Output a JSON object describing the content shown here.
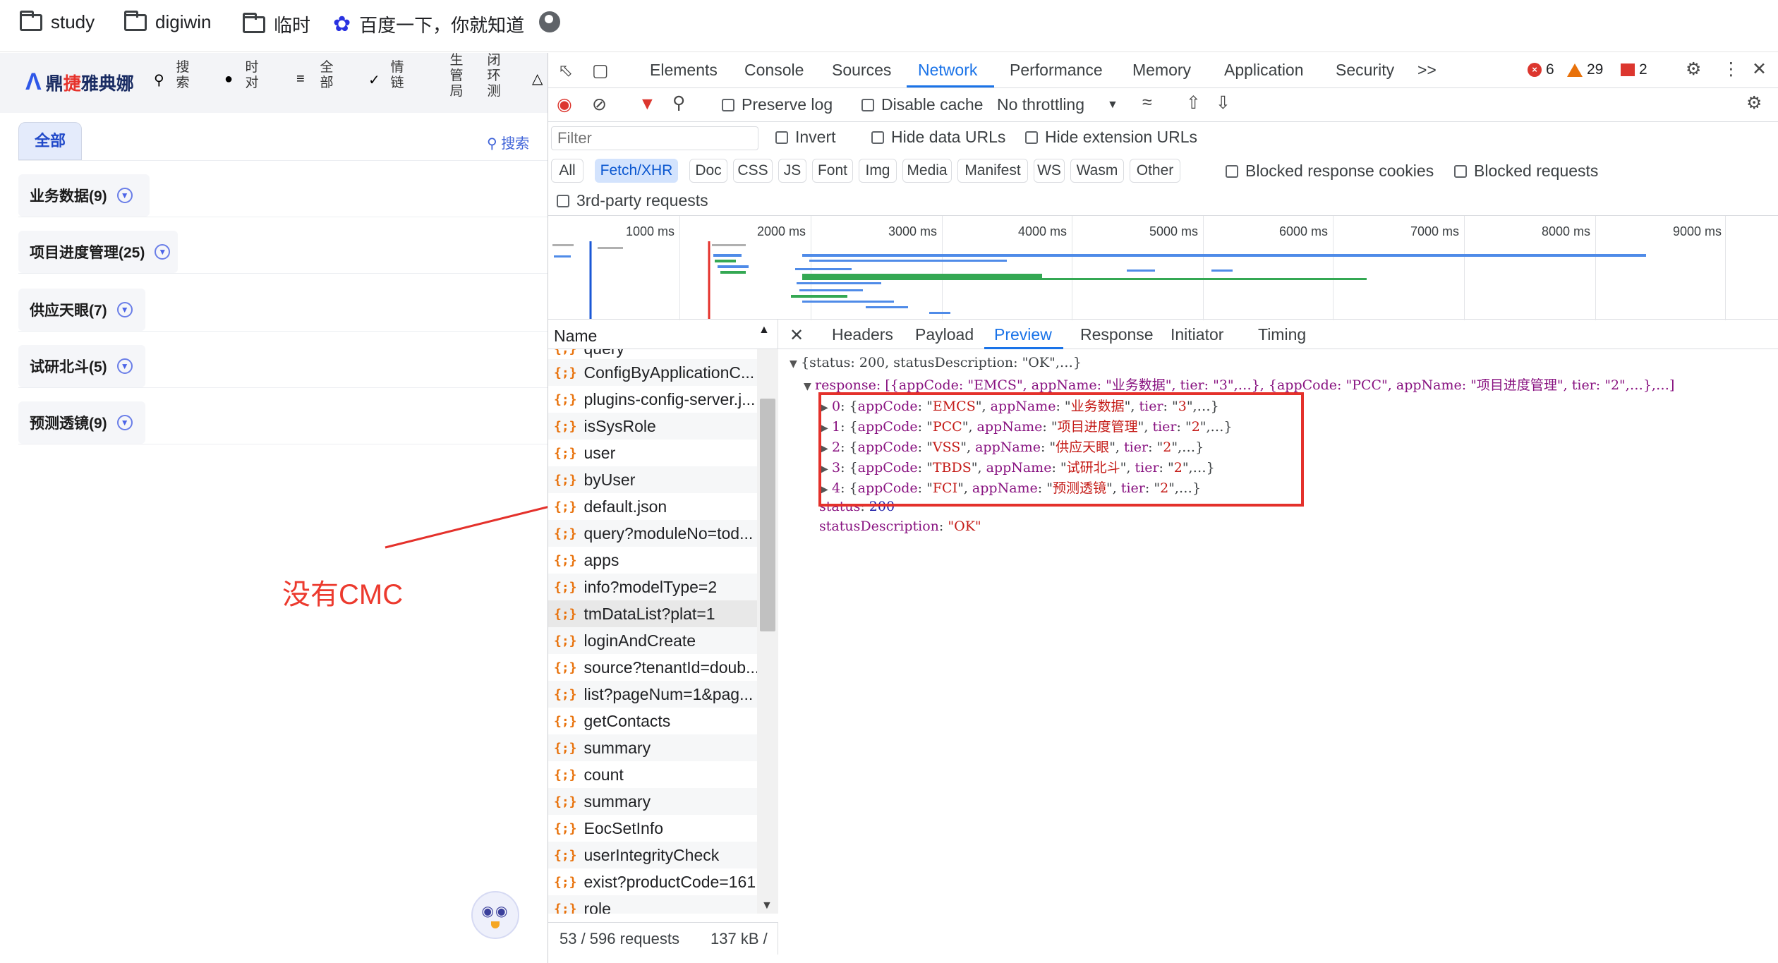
{
  "bookmarks": [
    {
      "label": "study",
      "icon": "folder-icon"
    },
    {
      "label": "digiwin",
      "icon": "folder-icon"
    },
    {
      "label": "临时",
      "icon": "folder-icon"
    },
    {
      "label": "百度一下，你就知道",
      "icon": "paw-icon"
    },
    {
      "label": "",
      "icon": "globe-icon"
    }
  ],
  "app": {
    "logo": {
      "pre": "鼎",
      "red": "捷",
      "post": "雅典娜"
    },
    "nav": [
      {
        "l1": "搜",
        "l2": "索",
        "icon": "search-icon"
      },
      {
        "l1": "时",
        "l2": "对",
        "icon": "chat-icon"
      },
      {
        "l1": "全",
        "l2": "部",
        "icon": "menu-icon"
      },
      {
        "l1": "情",
        "l2": "链",
        "icon": "link-icon"
      },
      {
        "l1": "生",
        "l2": "管",
        "l3": "局",
        "icon": ""
      },
      {
        "l1": "闭",
        "l2": "环",
        "l3": "测",
        "icon": ""
      }
    ],
    "all_tab": "全部",
    "search_label": "搜索",
    "categories": [
      {
        "label": "业务数据(9)"
      },
      {
        "label": "项目进度管理(25)"
      },
      {
        "label": "供应天眼(7)"
      },
      {
        "label": "试研北斗(5)"
      },
      {
        "label": "预测透镜(9)"
      }
    ]
  },
  "annotation": {
    "text": "没有CMC",
    "color": "#ec3a2e"
  },
  "devtools": {
    "tabs": [
      "Elements",
      "Console",
      "Sources",
      "Network",
      "Performance",
      "Memory",
      "Application",
      "Security"
    ],
    "more": ">>",
    "active_tab": "Network",
    "counts": {
      "errors": "6",
      "warnings": "29",
      "issues": "2"
    },
    "toolbar": {
      "preserve_log": "Preserve log",
      "disable_cache": "Disable cache",
      "throttling": "No throttling"
    },
    "filter": {
      "placeholder": "Filter",
      "invert": "Invert",
      "hide_data": "Hide data URLs",
      "hide_ext": "Hide extension URLs"
    },
    "types": [
      "All",
      "Fetch/XHR",
      "Doc",
      "CSS",
      "JS",
      "Font",
      "Img",
      "Media",
      "Manifest",
      "WS",
      "Wasm",
      "Other"
    ],
    "active_type": "Fetch/XHR",
    "blocked_cookies": "Blocked response cookies",
    "blocked_requests": "Blocked requests",
    "third_party": "3rd-party requests",
    "timeline_ticks": [
      "1000 ms",
      "2000 ms",
      "3000 ms",
      "4000 ms",
      "5000 ms",
      "6000 ms",
      "7000 ms",
      "8000 ms",
      "9000 ms"
    ],
    "name_header": "Name",
    "requests": [
      "query",
      "ConfigByApplicationC...",
      "plugins-config-server.j...",
      "isSysRole",
      "user",
      "byUser",
      "default.json",
      "query?moduleNo=tod...",
      "apps",
      "info?modelType=2",
      "tmDataList?plat=1",
      "loginAndCreate",
      "source?tenantId=doub...",
      "list?pageNum=1&pag...",
      "getContacts",
      "summary",
      "count",
      "summary",
      "EocSetInfo",
      "userIntegrityCheck",
      "exist?productCode=161",
      "role"
    ],
    "selected_request": "tmDataList?plat=1",
    "status": {
      "requests": "53 / 596 requests",
      "size": "137 kB /"
    },
    "detail_tabs": [
      "Headers",
      "Payload",
      "Preview",
      "Response",
      "Initiator",
      "Timing"
    ],
    "active_detail": "Preview",
    "preview": {
      "root": "{status: 200, statusDescription: \"OK\",…}",
      "response_line": "response: [{appCode: \"EMCS\", appName: \"业务数据\", tier: \"3\",…},  {appCode: \"PCC\", appName: \"项目进度管理\", tier: \"2\",…},…]",
      "items": [
        {
          "idx": "0",
          "code": "EMCS",
          "name": "业务数据",
          "tier": "3"
        },
        {
          "idx": "1",
          "code": "PCC",
          "name": "项目进度管理",
          "tier": "2"
        },
        {
          "idx": "2",
          "code": "VSS",
          "name": "供应天眼",
          "tier": "2"
        },
        {
          "idx": "3",
          "code": "TBDS",
          "name": "试研北斗",
          "tier": "2"
        },
        {
          "idx": "4",
          "code": "FCI",
          "name": "预测透镜",
          "tier": "2"
        }
      ],
      "status_key": "status",
      "status_val": "200",
      "desc_key": "statusDescription",
      "desc_val": "\"OK\""
    }
  },
  "colors": {
    "accent": "#1a73e8",
    "annotation_red": "#e4312b",
    "type_active_bg": "#d3e3fd"
  }
}
